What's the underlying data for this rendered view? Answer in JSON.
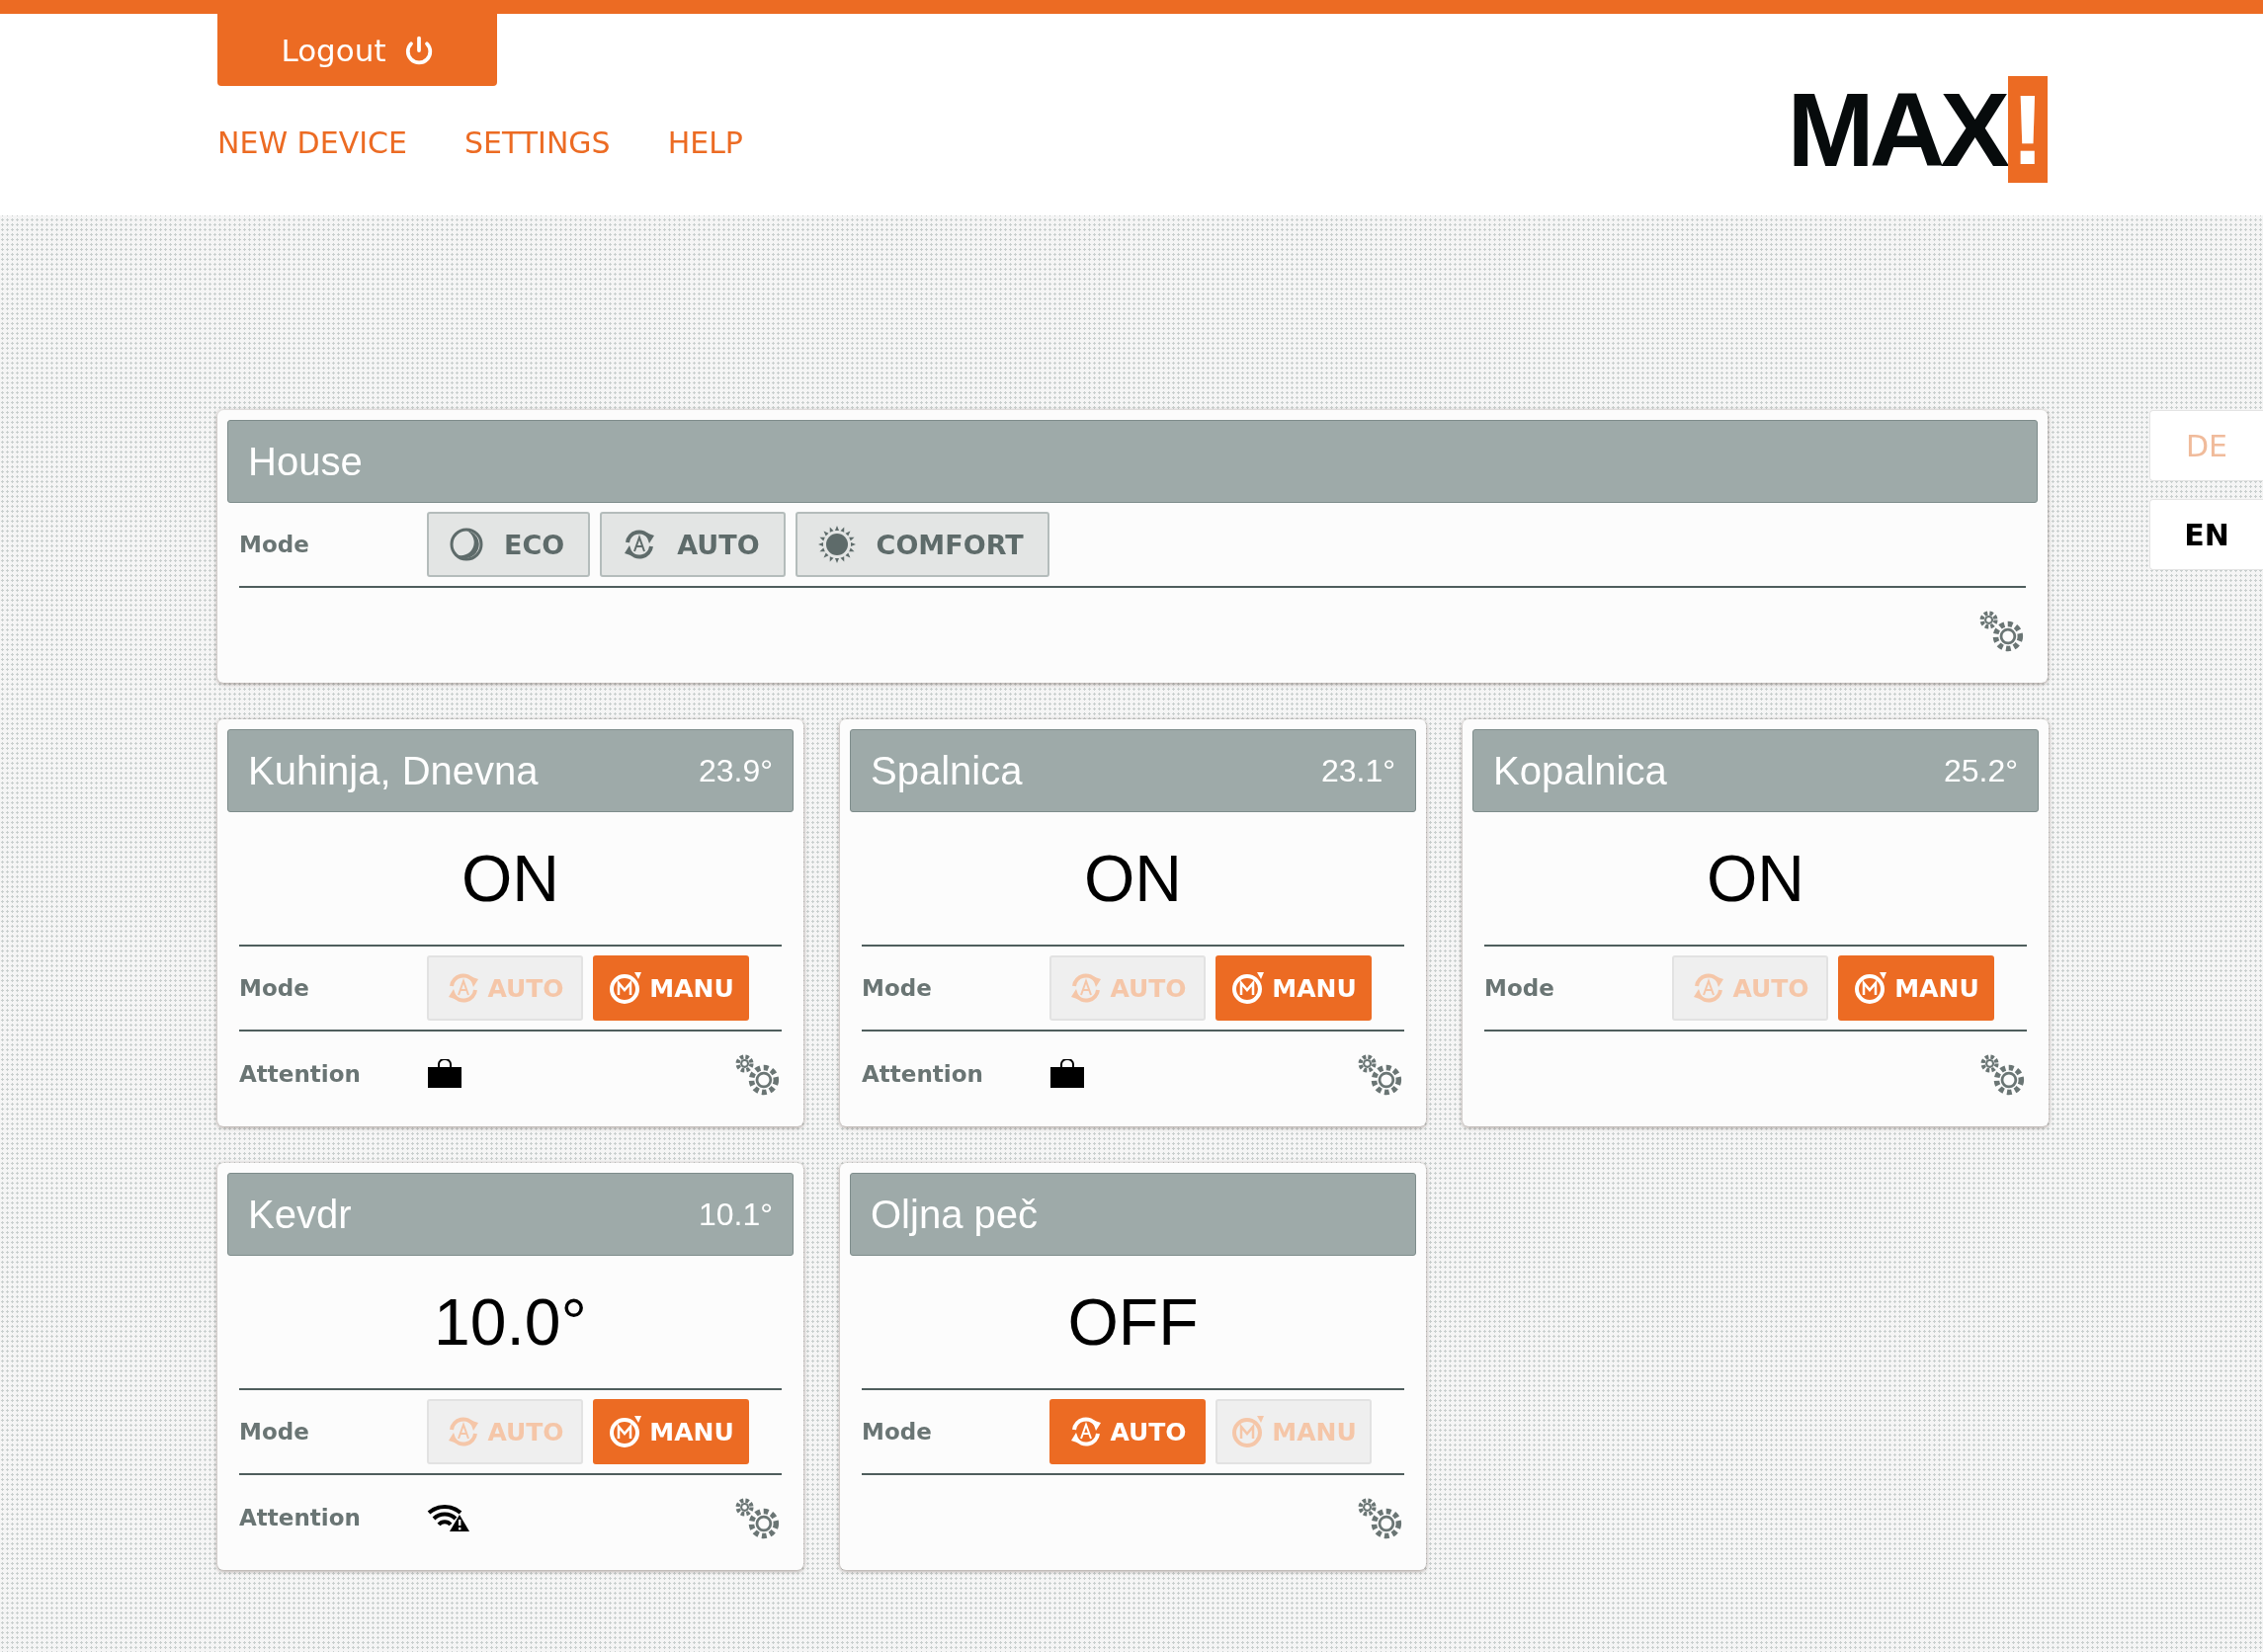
{
  "header": {
    "logout": "Logout",
    "nav": [
      "NEW DEVICE",
      "SETTINGS",
      "HELP"
    ],
    "logo": {
      "name": "MAX",
      "mark": "!"
    }
  },
  "languages": [
    {
      "label": "DE",
      "selected": false
    },
    {
      "label": "EN",
      "selected": true
    }
  ],
  "house": {
    "title": "House",
    "mode_label": "Mode",
    "modes": [
      {
        "label": "ECO",
        "kind": "eco"
      },
      {
        "label": "AUTO",
        "kind": "auto"
      },
      {
        "label": "COMFORT",
        "kind": "comfort"
      }
    ]
  },
  "rooms": [
    {
      "name": "Kuhinja, Dnevna",
      "temperature": "23.9°",
      "status": "ON",
      "mode_label": "Mode",
      "modes": [
        {
          "label": "AUTO",
          "kind": "auto",
          "selected": false
        },
        {
          "label": "MANU",
          "kind": "manu",
          "selected": true
        }
      ],
      "attention": {
        "label": "Attention",
        "kind": "bag"
      }
    },
    {
      "name": "Spalnica",
      "temperature": "23.1°",
      "status": "ON",
      "mode_label": "Mode",
      "modes": [
        {
          "label": "AUTO",
          "kind": "auto",
          "selected": false
        },
        {
          "label": "MANU",
          "kind": "manu",
          "selected": true
        }
      ],
      "attention": {
        "label": "Attention",
        "kind": "bag"
      }
    },
    {
      "name": "Kopalnica",
      "temperature": "25.2°",
      "status": "ON",
      "mode_label": "Mode",
      "modes": [
        {
          "label": "AUTO",
          "kind": "auto",
          "selected": false
        },
        {
          "label": "MANU",
          "kind": "manu",
          "selected": true
        }
      ]
    },
    {
      "name": "Kevdr",
      "temperature": "10.1°",
      "status": "10.0°",
      "mode_label": "Mode",
      "modes": [
        {
          "label": "AUTO",
          "kind": "auto",
          "selected": false
        },
        {
          "label": "MANU",
          "kind": "manu",
          "selected": true
        }
      ],
      "attention": {
        "label": "Attention",
        "kind": "signal"
      }
    },
    {
      "name": "Oljna peč",
      "status": "OFF",
      "mode_label": "Mode",
      "modes": [
        {
          "label": "AUTO",
          "kind": "auto",
          "selected": true
        },
        {
          "label": "MANU",
          "kind": "manu",
          "selected": false
        }
      ]
    }
  ]
}
